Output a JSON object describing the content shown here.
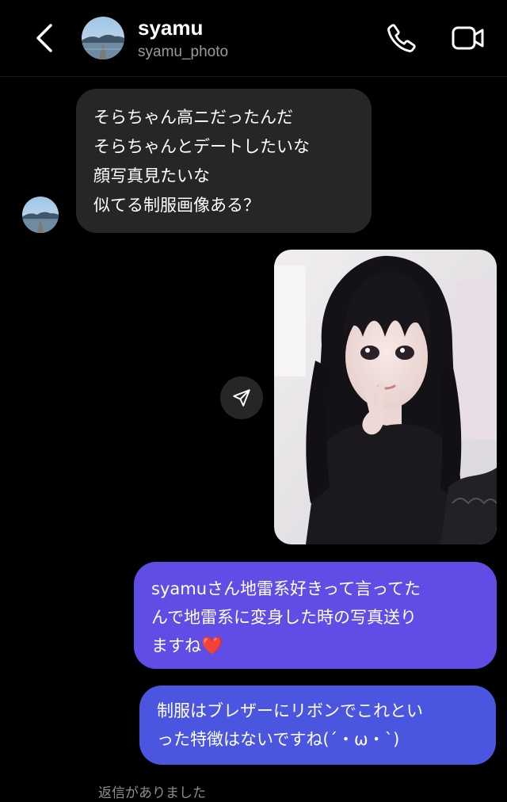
{
  "header": {
    "username": "syamu",
    "handle": "syamu_photo",
    "back_icon": "chevron-left-icon",
    "call_icon": "phone-icon",
    "video_icon": "video-camera-icon"
  },
  "messages": [
    {
      "direction": "incoming",
      "type": "text",
      "lines": [
        "そらちゃん高ニだったんだ",
        "そらちゃんとデートしたいな",
        "顔写真見たいな",
        "似てる制服画像ある？"
      ]
    },
    {
      "direction": "outgoing",
      "type": "photo",
      "share_icon": "send-arrow-icon"
    },
    {
      "direction": "outgoing",
      "type": "text",
      "lines": [
        "syamuさん地雷系好きって言ってた",
        "んで地雷系に変身した時の写真送り",
        "ますね"
      ],
      "emoji": "❤️"
    },
    {
      "direction": "outgoing",
      "type": "text",
      "lines": [
        "制服はブレザーにリボンでこれとい",
        "った特徴はないですね(´・ω・`)"
      ]
    }
  ],
  "footer_note": "返信がありました",
  "colors": {
    "background": "#000000",
    "incoming_bubble": "#262626",
    "outgoing_bubble_top": "#5f4de6",
    "outgoing_bubble_bottom": "#4a55e0",
    "heart": "#e0192e"
  }
}
